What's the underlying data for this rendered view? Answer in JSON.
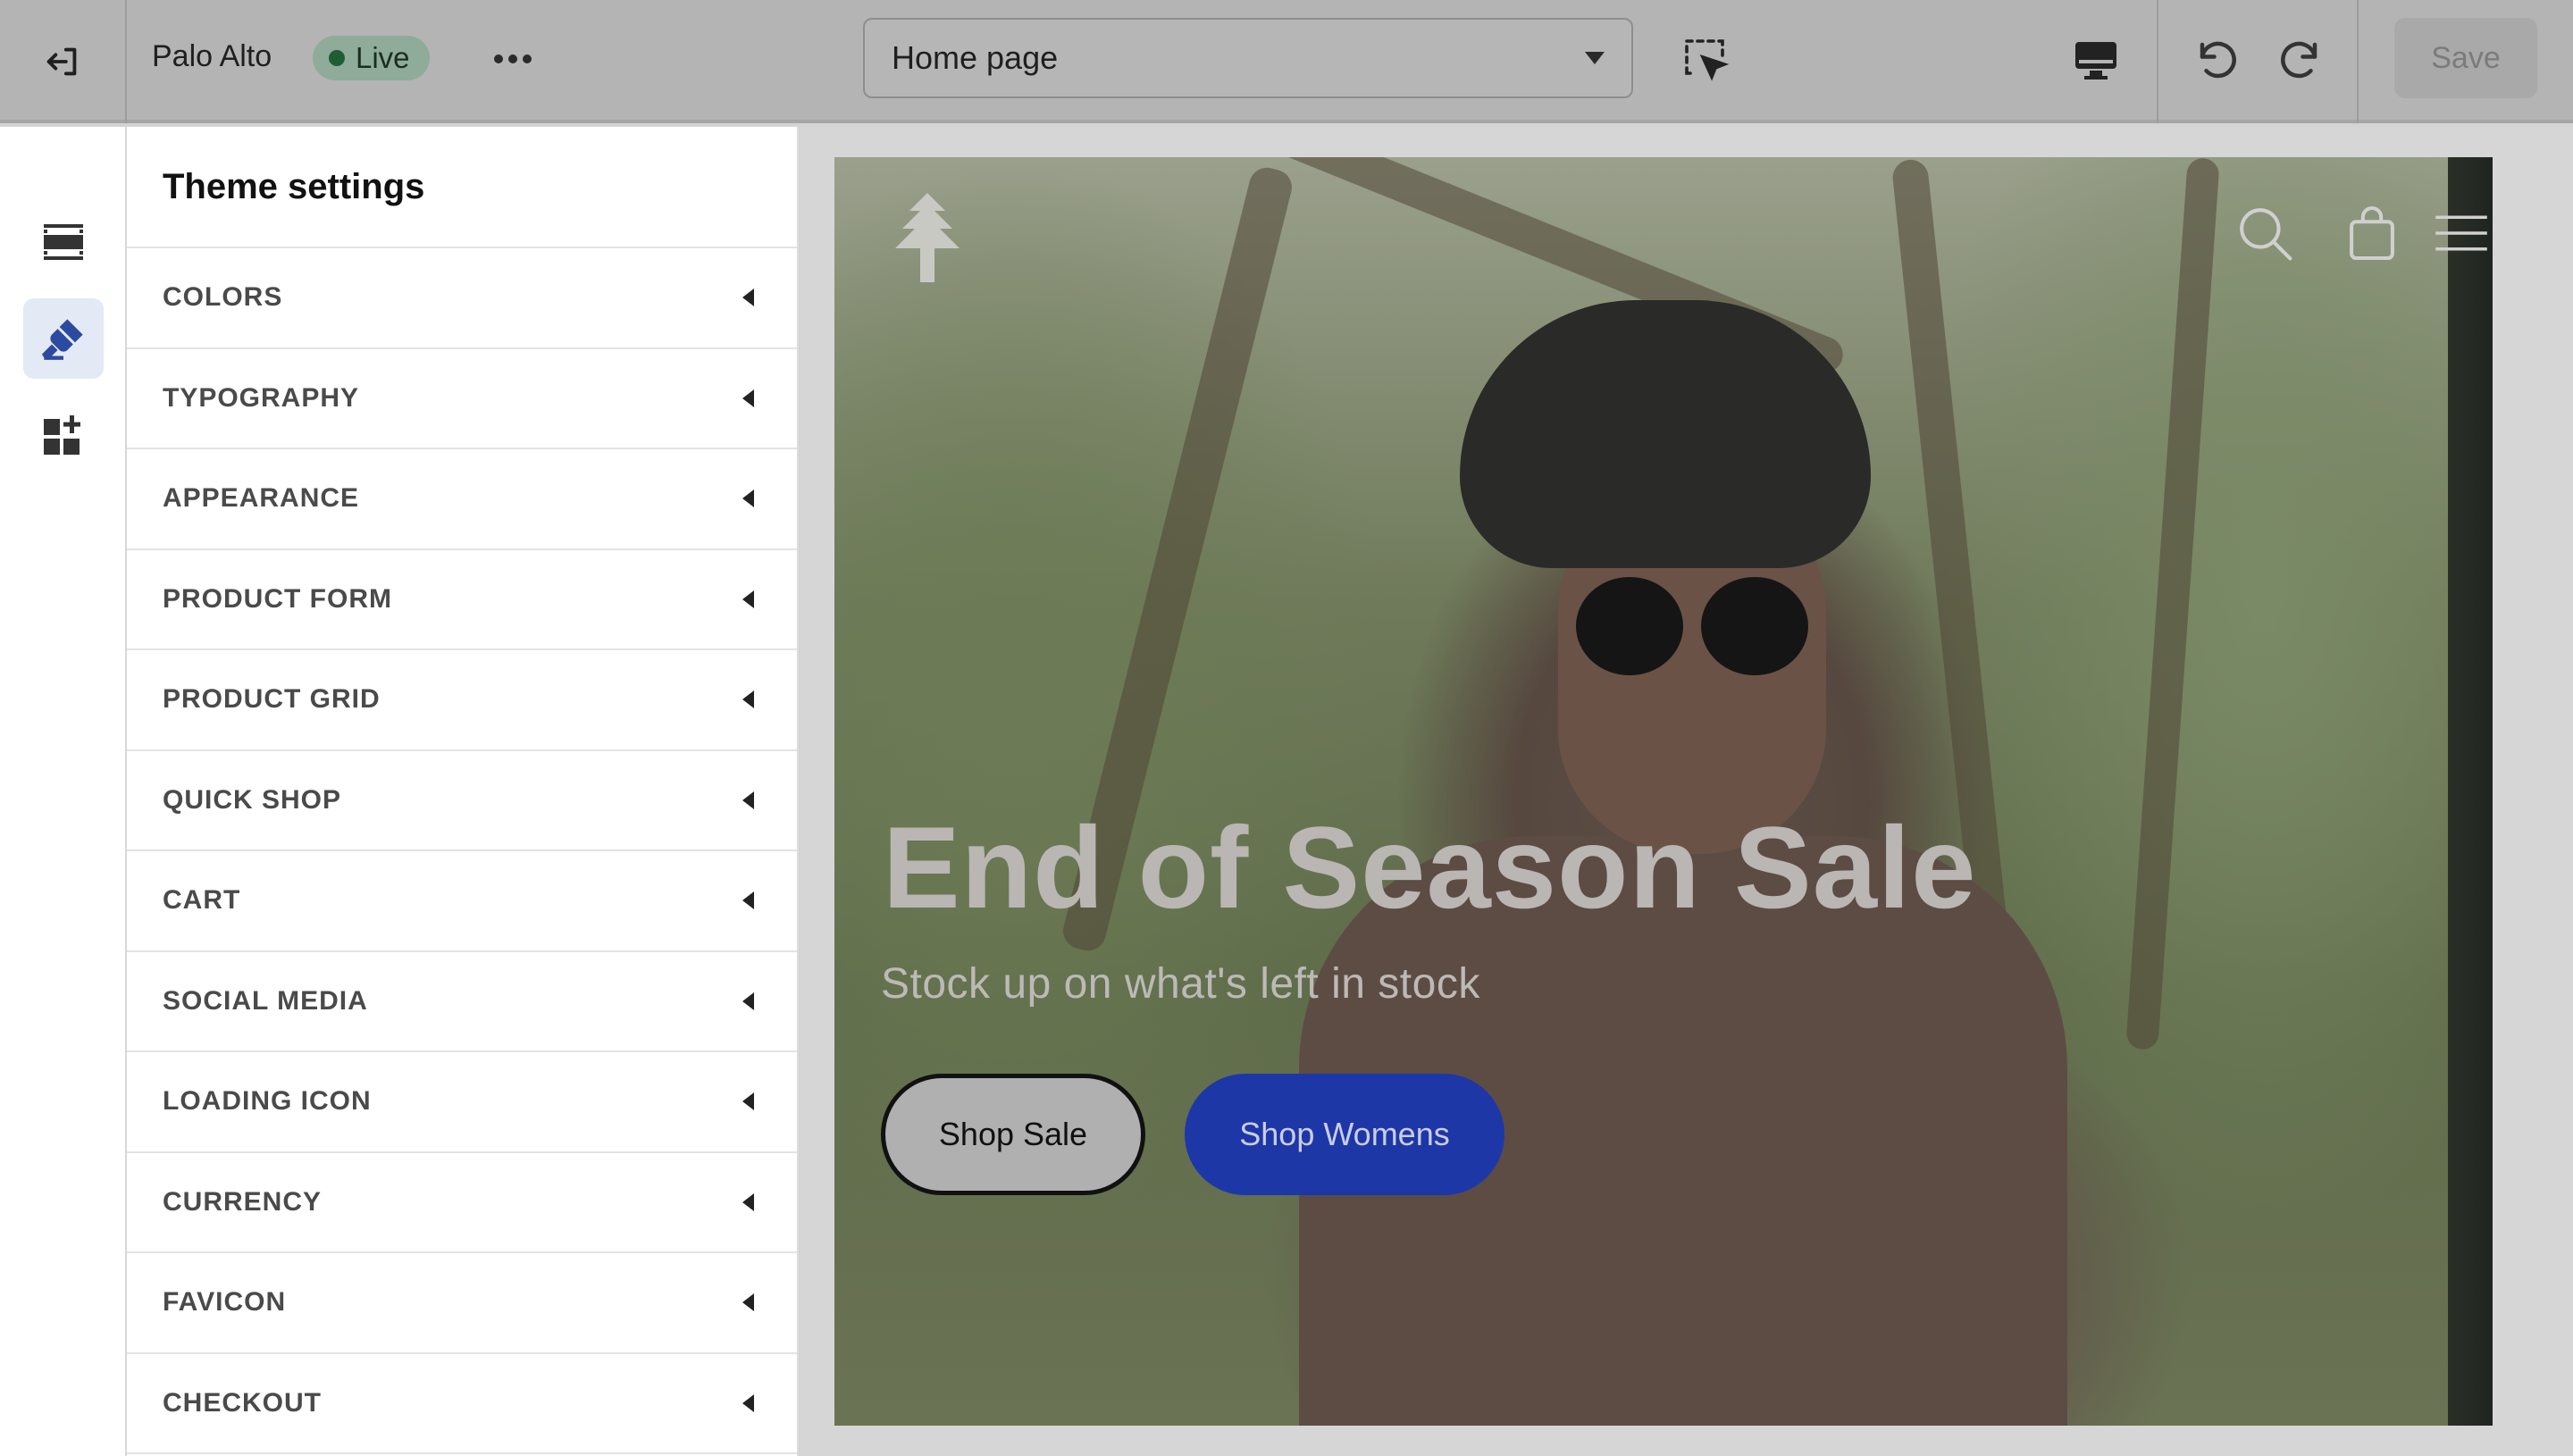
{
  "topbar": {
    "store_name": "Palo Alto",
    "status_badge": "Live",
    "page_selector": {
      "value": "Home page"
    },
    "save_label": "Save"
  },
  "rail": {
    "items": [
      {
        "icon": "sections-icon"
      },
      {
        "icon": "theme-settings-icon",
        "active": true
      },
      {
        "icon": "apps-icon"
      }
    ]
  },
  "panel": {
    "title": "Theme settings",
    "items": [
      {
        "label": "COLORS"
      },
      {
        "label": "TYPOGRAPHY"
      },
      {
        "label": "APPEARANCE"
      },
      {
        "label": "PRODUCT FORM"
      },
      {
        "label": "PRODUCT GRID"
      },
      {
        "label": "QUICK SHOP"
      },
      {
        "label": "CART"
      },
      {
        "label": "SOCIAL MEDIA"
      },
      {
        "label": "LOADING ICON"
      },
      {
        "label": "CURRENCY"
      },
      {
        "label": "FAVICON"
      },
      {
        "label": "CHECKOUT"
      }
    ]
  },
  "preview": {
    "hero": {
      "title": "End of Season Sale",
      "subtitle": "Stock up on what's left in stock",
      "primary_button": "Shop Sale",
      "secondary_button": "Shop Womens"
    }
  },
  "colors": {
    "accent": "#1e37a6",
    "live_badge": "#8fab99",
    "active_rail": "#2c4aa0"
  }
}
